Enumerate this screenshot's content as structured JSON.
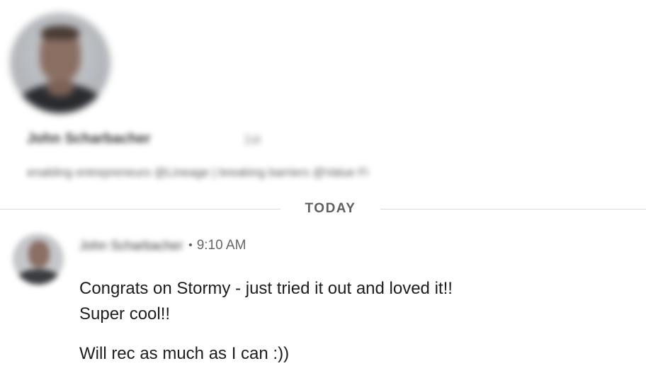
{
  "profile": {
    "name": "John Scharbacher",
    "pronoun": "1st",
    "headline": "enabling entrepreneurs @Lineage | breaking barriers @Value Fi"
  },
  "divider": {
    "label": "TODAY"
  },
  "message": {
    "sender": "John Scharbacher",
    "separator": "•",
    "time": "9:10 AM",
    "lines": [
      "Congrats on Stormy - just tried it out and loved it!!",
      "Super cool!!"
    ],
    "paragraph2": "Will rec as much as I can :))"
  }
}
